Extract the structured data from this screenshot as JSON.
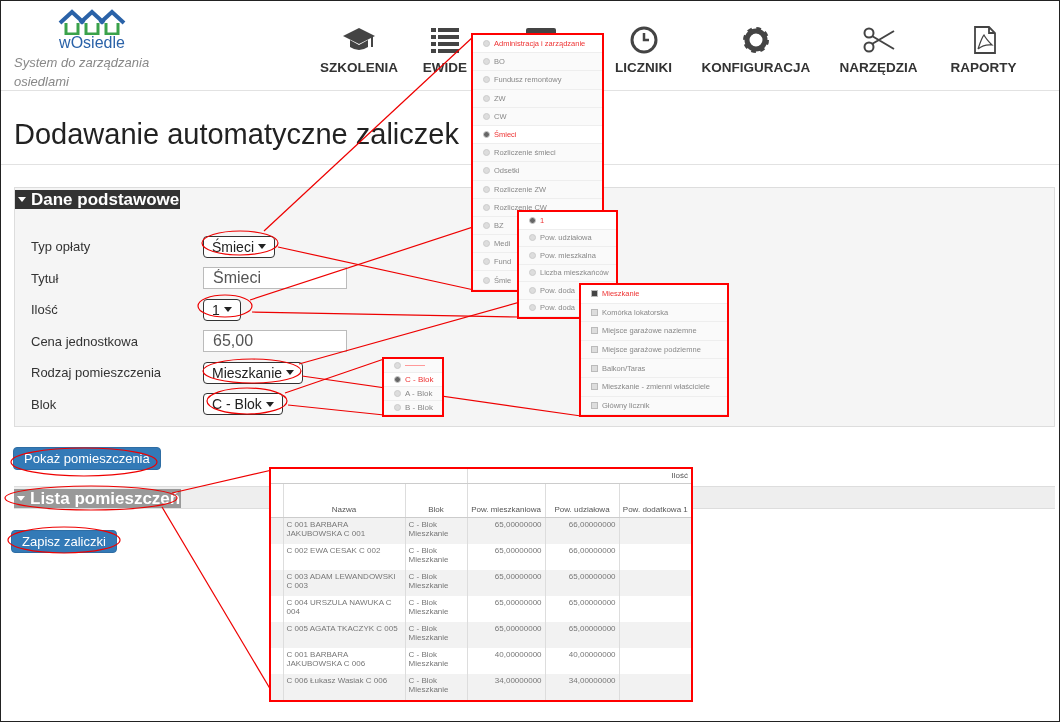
{
  "header": {
    "logo_text": "wOsiedle",
    "tagline": "System do zarządzania osiedlami",
    "nav": [
      {
        "kind": "cap",
        "label": "SZKOLENIA"
      },
      {
        "kind": "list",
        "label": "EWIDE"
      },
      {
        "kind": "card"
      },
      {
        "kind": "clock",
        "label": "LICZNIKI"
      },
      {
        "kind": "gear",
        "label": "KONFIGURACJA"
      },
      {
        "kind": "scissors",
        "label": "NARZĘDZIA"
      },
      {
        "kind": "pdf",
        "label": "RAPORTY"
      }
    ]
  },
  "title": "Dodawanie automatyczne zaliczek",
  "basic_section": {
    "title": "Dane podstawowe",
    "expanded": true,
    "fields": [
      {
        "kind": "dropdown",
        "label": "Typ opłaty",
        "value": "Śmieci"
      },
      {
        "kind": "text",
        "label": "Tytuł",
        "value": "Śmieci"
      },
      {
        "kind": "dropdown",
        "label": "Ilość",
        "value": "1"
      },
      {
        "kind": "text",
        "label": "Cena jednostkowa",
        "value": "65,00"
      },
      {
        "kind": "dropdown",
        "label": "Rodzaj pomieszczenia",
        "value": "Mieszkanie"
      },
      {
        "kind": "dropdown",
        "label": "Blok",
        "value": "C - Blok"
      }
    ]
  },
  "show_button": "Pokaż pomieszczenia",
  "rooms_section": {
    "title": "Lista pomieszczeń",
    "expanded": true
  },
  "save_button": "Zapisz zaliczki",
  "callouts": {
    "fee_type_options": [
      {
        "label": "Administracja i zarządzanie",
        "selected": false,
        "highlighted": true
      },
      {
        "label": "BO",
        "selected": false,
        "highlighted": false
      },
      {
        "label": "Fundusz remontowy",
        "selected": false,
        "highlighted": false
      },
      {
        "label": "ZW",
        "selected": false,
        "highlighted": false
      },
      {
        "label": "CW",
        "selected": false,
        "highlighted": false
      },
      {
        "label": "Śmieci",
        "selected": true,
        "highlighted": true
      },
      {
        "label": "Rozliczenie śmieci",
        "selected": false,
        "highlighted": false
      },
      {
        "label": "Odsetki",
        "selected": false,
        "highlighted": false
      },
      {
        "label": "Rozliczenie ZW",
        "selected": false,
        "highlighted": false
      },
      {
        "label": "Rozliczenie CW",
        "selected": false,
        "highlighted": false
      },
      {
        "label": "BZ",
        "selected": false,
        "highlighted": false
      },
      {
        "label": "Medi",
        "selected": false,
        "highlighted": false
      },
      {
        "label": "Fund",
        "selected": false,
        "highlighted": false
      },
      {
        "label": "Śmie",
        "selected": false,
        "highlighted": false
      }
    ],
    "quantity_options": [
      {
        "label": "1",
        "selected": true
      },
      {
        "label": "Pow. udziałowa",
        "selected": false
      },
      {
        "label": "Pow. mieszkalna",
        "selected": false
      },
      {
        "label": "Liczba mieszkańców",
        "selected": false
      },
      {
        "label": "Pow. doda",
        "selected": false
      },
      {
        "label": "Pow. doda",
        "selected": false
      }
    ],
    "room_type_options": [
      {
        "label": "Mieszkanie",
        "checked": true
      },
      {
        "label": "Komórka lokatorska",
        "checked": false
      },
      {
        "label": "Miejsce garażowe naziemne",
        "checked": false
      },
      {
        "label": "Miejsce garażowe podziemne",
        "checked": false
      },
      {
        "label": "Balkon/Taras",
        "checked": false
      },
      {
        "label": "Mieszkanie - zmienni właściciele",
        "checked": false
      },
      {
        "label": "Główny licznik",
        "checked": false
      }
    ],
    "block_options": [
      {
        "kind": "blank",
        "selected": false
      },
      {
        "kind": "option",
        "label": "C - Blok",
        "selected": true
      },
      {
        "kind": "option",
        "label": "A - Blok",
        "selected": false
      },
      {
        "kind": "option",
        "label": "B - Blok",
        "selected": false
      }
    ],
    "rooms_table": {
      "group_header": "Ilość",
      "columns": [
        "Nazwa",
        "Blok",
        "Pow. mieszkaniowa",
        "Pow. udziałowa",
        "Pow. dodatkowa 1"
      ],
      "rows": [
        [
          "C 001 BARBARA JAKUBOWSKA C 001",
          "C - Blok Mieszkanie",
          "65,00000000",
          "66,00000000"
        ],
        [
          "C 002 EWA CESAK C 002",
          "C - Blok Mieszkanie",
          "65,00000000",
          "66,00000000"
        ],
        [
          "C 003 ADAM LEWANDOWSKI C 003",
          "C - Blok Mieszkanie",
          "65,00000000",
          "65,00000000"
        ],
        [
          "C 004 URSZULA NAWUKA C 004",
          "C - Blok Mieszkanie",
          "65,00000000",
          "65,00000000"
        ],
        [
          "C 005 AGATA TKACZYK C 005",
          "C - Blok Mieszkanie",
          "65,00000000",
          "65,00000000"
        ],
        [
          "C 001 BARBARA JAKUBOWSKA C 006",
          "C - Blok Mieszkanie",
          "40,00000000",
          "40,00000000"
        ],
        [
          "C 006 Łukasz Wasiak C 006",
          "C - Blok Mieszkanie",
          "34,00000000",
          "34,00000000"
        ]
      ]
    }
  }
}
